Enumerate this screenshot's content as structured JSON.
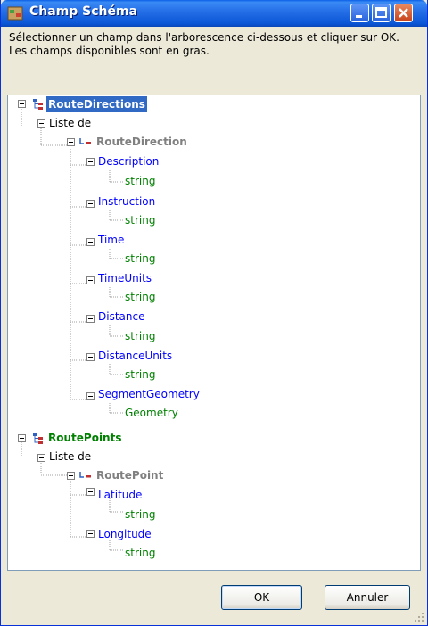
{
  "window": {
    "title": "Champ Schéma",
    "instruction": "Sélectionner un champ dans l'arborescence ci-dessous et cliquer sur OK. Les champs disponibles sont en gras."
  },
  "tree": {
    "route_directions": "RouteDirections",
    "liste_de_1": "Liste de",
    "route_direction": "RouteDirection",
    "description": "Description",
    "instruction": "Instruction",
    "time": "Time",
    "time_units": "TimeUnits",
    "distance": "Distance",
    "distance_units": "DistanceUnits",
    "segment_geometry": "SegmentGeometry",
    "type_string": "string",
    "type_geometry": "Geometry",
    "route_points": "RoutePoints",
    "liste_de_2": "Liste de",
    "route_point": "RoutePoint",
    "latitude": "Latitude",
    "longitude": "Longitude"
  },
  "buttons": {
    "ok": "OK",
    "cancel": "Annuler"
  },
  "colors": {
    "selection": "#316ac5",
    "field_blue": "#0000ff",
    "available_green": "#008000",
    "disabled_gray": "#808080"
  }
}
